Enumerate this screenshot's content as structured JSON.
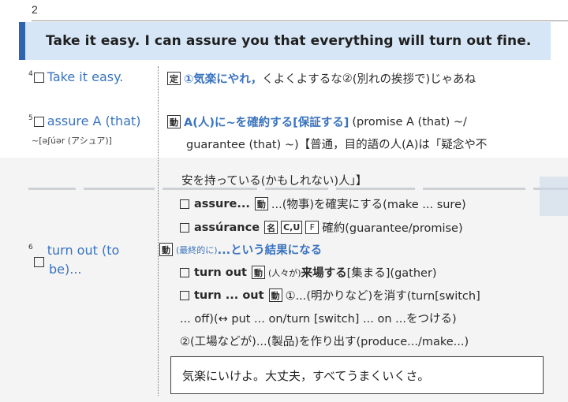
{
  "page_number": "2",
  "sentence": "Take it easy. I can assure you that everything will turn out fine.",
  "entries": [
    {
      "num": "4",
      "head": "Take it easy.",
      "lines": [
        {
          "tag": "定",
          "parts": [
            "①気楽にやれ，",
            "くよくよするな",
            "②",
            "(別れの挨拶で)じゃあね"
          ]
        }
      ]
    },
    {
      "num": "5",
      "head": "assure A (that)",
      "head2": "~[əʃúər (アシュア)]",
      "lines": [
        {
          "tag": "動",
          "parts": [
            "A(人)に~を確約する[保証する]",
            "(promise A (that) ~/"
          ]
        },
        {
          "parts": [
            "guarantee (that) ~)【普通，目的語の人(A)は「疑念や不"
          ]
        },
        {
          "parts": [
            "安を持っている(かもしれない)人」】"
          ]
        },
        {
          "parts": [
            "assure...",
            "動",
            "...(物事)を確実にする(make ... sure)"
          ]
        },
        {
          "parts": [
            "assúrance",
            "名",
            "C,U",
            "F",
            "確約(guarantee/promise)"
          ]
        }
      ]
    },
    {
      "num": "6",
      "head": "turn out (to",
      "head2": "be)...",
      "lines": [
        {
          "tag": "動",
          "parts": [
            "(最終的に)",
            "...という結果になる"
          ]
        },
        {
          "parts": [
            "turn out",
            "動",
            "(人々が)",
            "来場する",
            "[集まる](gather)"
          ]
        },
        {
          "parts": [
            "turn ... out",
            "動",
            "①...(明かりなど)を消す(turn[switch]"
          ]
        },
        {
          "parts": [
            "... off)(↔ put ... on/turn [switch] ... on ...をつける)"
          ]
        },
        {
          "parts": [
            "②(工場などが)...(製品)を作り出す(produce.../make...)"
          ]
        }
      ]
    }
  ],
  "summary": "気楽にいけよ。大丈夫，すべてうまくいくさ。"
}
